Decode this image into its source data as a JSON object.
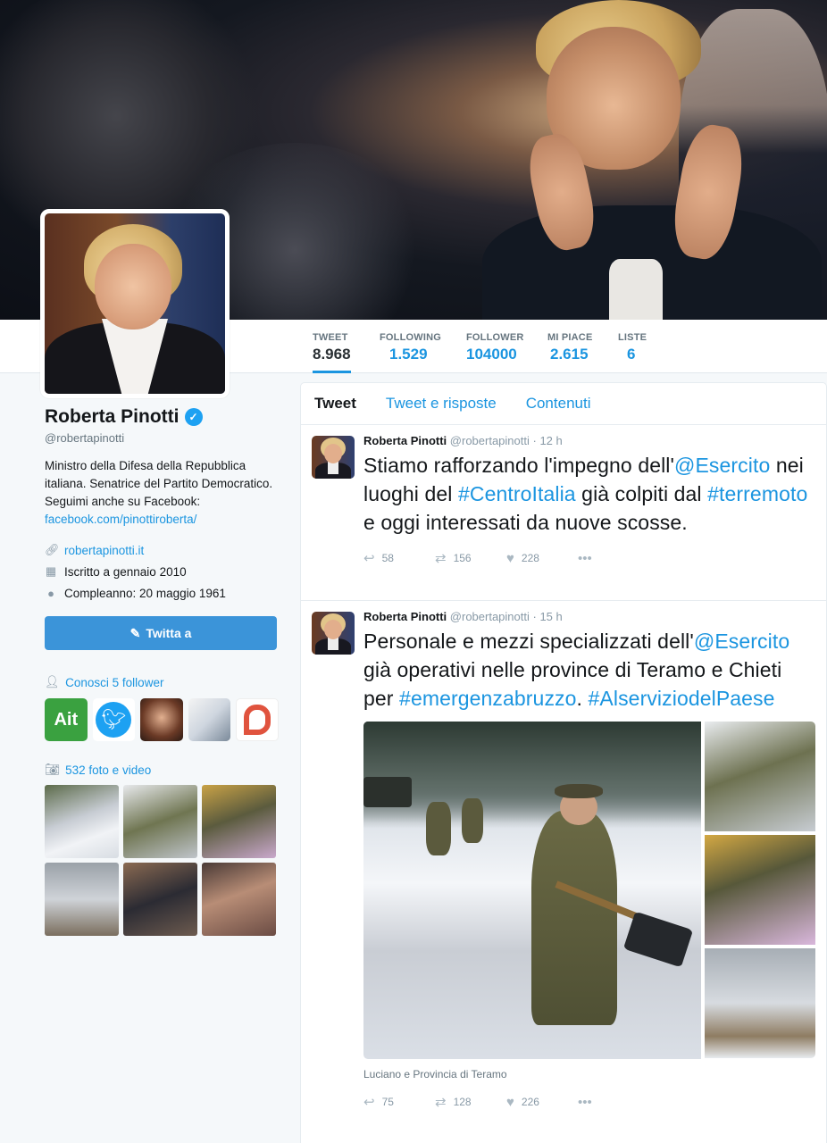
{
  "profile": {
    "name": "Roberta Pinotti",
    "handle": "@robertapinotti",
    "bio_text": "Ministro della Difesa della Repubblica italiana. Senatrice del Partito Democratico. Seguimi anche su Facebook: ",
    "bio_link": "facebook.com/pinottiroberta/",
    "website": "robertapinotti.it",
    "joined": "Iscritto a gennaio 2010",
    "birthday": "Compleanno: 20 maggio 1961",
    "tweet_to_label": "Twitta a",
    "followers_known": "Conosci 5 follower",
    "media_count": "532 foto e video"
  },
  "stats": [
    {
      "label": "TWEET",
      "value": "8.968"
    },
    {
      "label": "FOLLOWING",
      "value": "1.529"
    },
    {
      "label": "FOLLOWER",
      "value": "104000"
    },
    {
      "label": "MI PIACE",
      "value": "2.615"
    },
    {
      "label": "LISTE",
      "value": "6"
    }
  ],
  "tabs": [
    "Tweet",
    "Tweet e risposte",
    "Contenuti"
  ],
  "tweets": [
    {
      "name": "Roberta Pinotti",
      "handle": "@robertapinotti",
      "time": "· 12 h",
      "parts": [
        "Stiamo rafforzando l'impegno dell'",
        "@Esercito",
        " nei luoghi del ",
        "#CentroItalia",
        " già colpiti dal ",
        "#terremoto",
        " e oggi interessati da nuove scosse."
      ],
      "replies": "58",
      "retweets": "156",
      "likes": "228"
    },
    {
      "name": "Roberta Pinotti",
      "handle": "@robertapinotti",
      "time": "· 15 h",
      "parts": [
        "Personale e mezzi specializzati dell'",
        "@Esercito",
        " già operativi nelle province di Teramo e Chieti per ",
        "#emergenzabruzzo",
        ". ",
        "#AlserviziodelPaese"
      ],
      "caption": "Luciano e Provincia di Teramo",
      "replies": "75",
      "retweets": "128",
      "likes": "226"
    }
  ],
  "colors": {
    "accent": "#1b95e0",
    "button": "#3b94d9",
    "verified": "#1da1f2"
  },
  "icons": [
    "link-icon",
    "calendar-icon",
    "balloon-icon",
    "person-icon",
    "camera-icon",
    "reply-icon",
    "retweet-icon",
    "heart-icon",
    "more-icon",
    "verified-icon",
    "compose-icon"
  ]
}
